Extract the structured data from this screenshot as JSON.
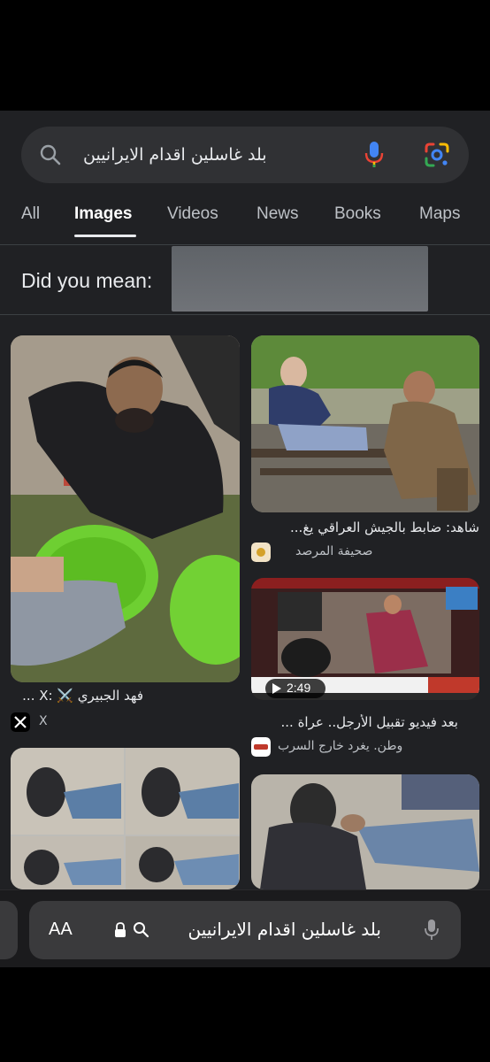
{
  "search": {
    "query": "بلد غاسلين اقدام الايرانيين"
  },
  "tabs": [
    {
      "label": "All",
      "active": false
    },
    {
      "label": "Images",
      "active": true
    },
    {
      "label": "Videos",
      "active": false
    },
    {
      "label": "News",
      "active": false
    },
    {
      "label": "Books",
      "active": false
    },
    {
      "label": "Maps",
      "active": false
    }
  ],
  "did_you_mean": {
    "label": "Did you mean:"
  },
  "results": [
    {
      "caption": "فهد الجبيري ⚔️ :X ...",
      "source": "X"
    },
    {
      "caption": "شاهد: ضابط بالجيش العراقي يغ...",
      "source": "صحيفة المرصد"
    },
    {
      "caption": "بعد فيديو تقبيل الأرجل.. عراة ...",
      "source": "وطن. يغرد خارج السرب",
      "duration": "2:49"
    }
  ],
  "browser": {
    "aa_label": "AA",
    "url_text": "بلد غاسلين اقدام الايرانيين"
  },
  "colors": {
    "background": "#202124",
    "search_bar": "#303134",
    "google_blue": "#4285f4",
    "google_red": "#ea4335",
    "google_yellow": "#fbbc05",
    "google_green": "#34a853"
  }
}
